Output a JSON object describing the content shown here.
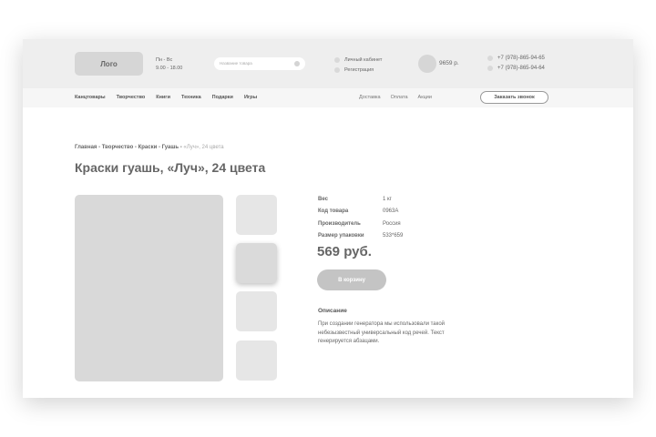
{
  "header": {
    "logo": "Лого",
    "hours_days": "Пн - Вс",
    "hours_time": "9.00 - 18.00",
    "search_placeholder": "Название товара",
    "account": "Личный кабинет",
    "register": "Регистрация",
    "balance": "9659 р.",
    "phone1": "+7 (978)-865-94-65",
    "phone2": "+7 (978)-865-94-64"
  },
  "nav": {
    "categories": [
      "Канцтовары",
      "Творчество",
      "Книги",
      "Техника",
      "Подарки",
      "Игры"
    ],
    "links": [
      "Доставка",
      "Оплата",
      "Акции"
    ],
    "call_button": "Заказать звонок"
  },
  "breadcrumb": {
    "path": "Главная - Творчество - Краски - Гуашь -",
    "current": "«Луч», 24 цвета"
  },
  "product": {
    "title": "Краски гуашь, «Луч», 24 цвета",
    "specs": [
      {
        "label": "Вес",
        "value": "1 кг"
      },
      {
        "label": "Код товара",
        "value": "0963А"
      },
      {
        "label": "Производитель",
        "value": "Россия"
      },
      {
        "label": "Размер упаковки",
        "value": "533*659"
      }
    ],
    "price": "569 руб.",
    "buy_button": "В корзину",
    "description_title": "Описание",
    "description": "При создании генератора мы использовали такой небезызвестный универсальный код речей. Текст генерируется абзацами."
  }
}
